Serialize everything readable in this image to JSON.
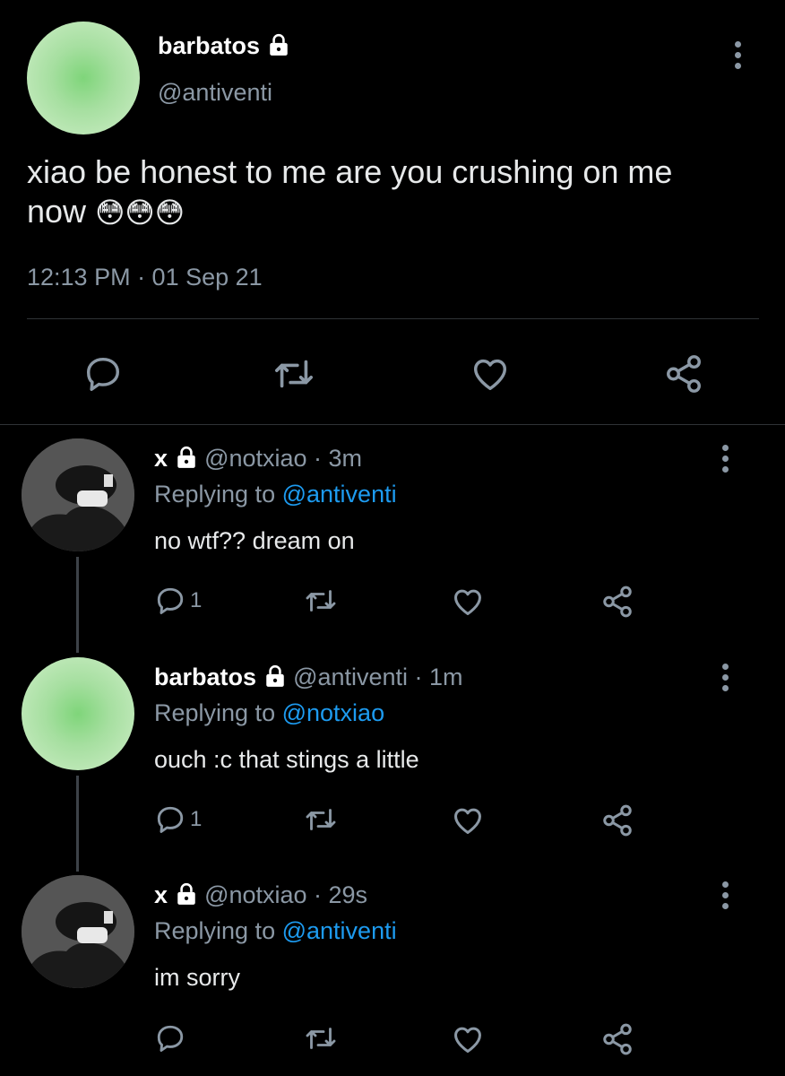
{
  "main_tweet": {
    "display_name": "barbatos",
    "handle": "@antiventi",
    "text_line1": "xiao be honest to me are you crushing on me",
    "text_line2": "now",
    "emojis": "😳😳😳",
    "timestamp": "12:13 PM · 01 Sep 21"
  },
  "replies": [
    {
      "display_name": "x",
      "meta": "@notxiao · 3m",
      "replying_prefix": "Replying to",
      "replying_to": "@antiventi",
      "text": "no wtf?? dream on",
      "reply_count": "1"
    },
    {
      "display_name": "barbatos",
      "meta": "@antiventi · 1m",
      "replying_prefix": "Replying to",
      "replying_to": "@notxiao",
      "text": "ouch :c that stings a little",
      "reply_count": "1"
    },
    {
      "display_name": "x",
      "meta": "@notxiao · 29s",
      "replying_prefix": "Replying to",
      "replying_to": "@antiventi",
      "text": "im sorry",
      "reply_count": ""
    }
  ],
  "icons": [
    "more-vertical-icon",
    "lock-icon",
    "reply-icon",
    "retweet-icon",
    "like-icon",
    "share-icon"
  ],
  "colors": {
    "background": "#000000",
    "link": "#1d9bf0",
    "muted": "#8b98a5",
    "text": "#d9d9d9"
  }
}
